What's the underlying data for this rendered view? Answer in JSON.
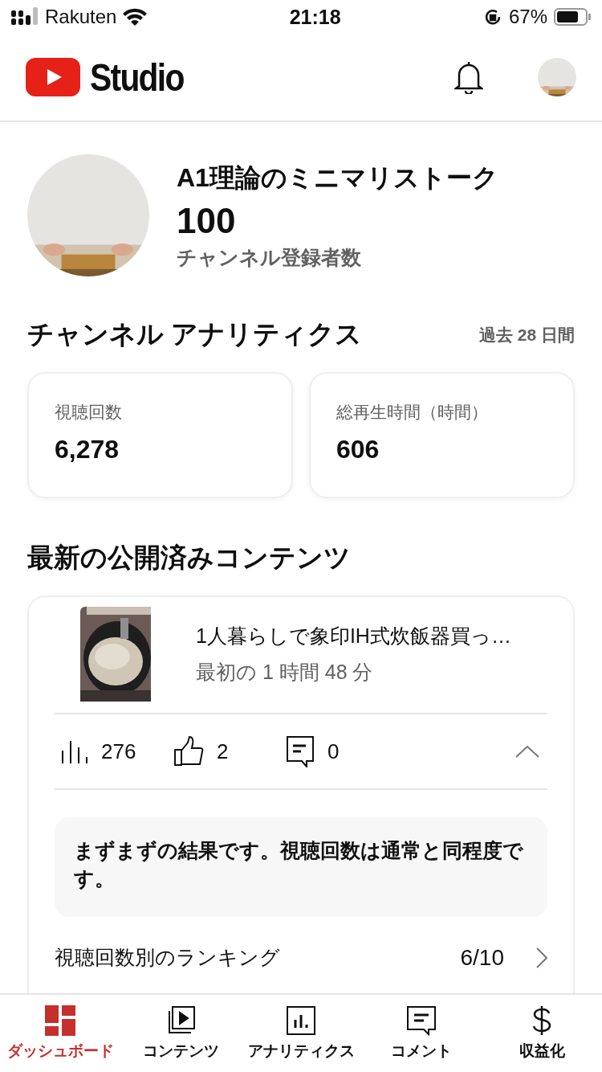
{
  "status_bar": {
    "carrier": "Rakuten",
    "time": "21:18",
    "battery": "67%"
  },
  "header": {
    "logo_text": "Studio"
  },
  "channel": {
    "name": "A1理論のミニマリストーク",
    "subscribers": "100",
    "subscribers_label": "チャンネル登録者数"
  },
  "analytics": {
    "title": "チャンネル アナリティクス",
    "period": "過去 28 日間",
    "metrics": [
      {
        "label": "視聴回数",
        "value": "6,278"
      },
      {
        "label": "総再生時間（時間）",
        "value": "606"
      }
    ]
  },
  "latest": {
    "title": "最新の公開済みコンテンツ",
    "video": {
      "title": "1人暮らしで象印IH式炊飯器買っ…",
      "subtitle": "最初の 1 時間 48 分"
    },
    "stats": [
      {
        "kind": "views",
        "value": "276"
      },
      {
        "kind": "likes",
        "value": "2"
      },
      {
        "kind": "comments",
        "value": "0"
      }
    ],
    "expanded": true,
    "insight": "まずまずの結果です。視聴回数は通常と同程度です。",
    "ranking": {
      "label": "視聴回数別のランキング",
      "value": "6/10"
    }
  },
  "nav": {
    "items": [
      {
        "kind": "dashboard",
        "label": "ダッシュボード",
        "selected": true
      },
      {
        "kind": "content",
        "label": "コンテンツ",
        "selected": false
      },
      {
        "kind": "analytics",
        "label": "アナリティクス",
        "selected": false
      },
      {
        "kind": "comments",
        "label": "コメント",
        "selected": false
      },
      {
        "kind": "earn",
        "label": "収益化",
        "selected": false
      }
    ]
  }
}
